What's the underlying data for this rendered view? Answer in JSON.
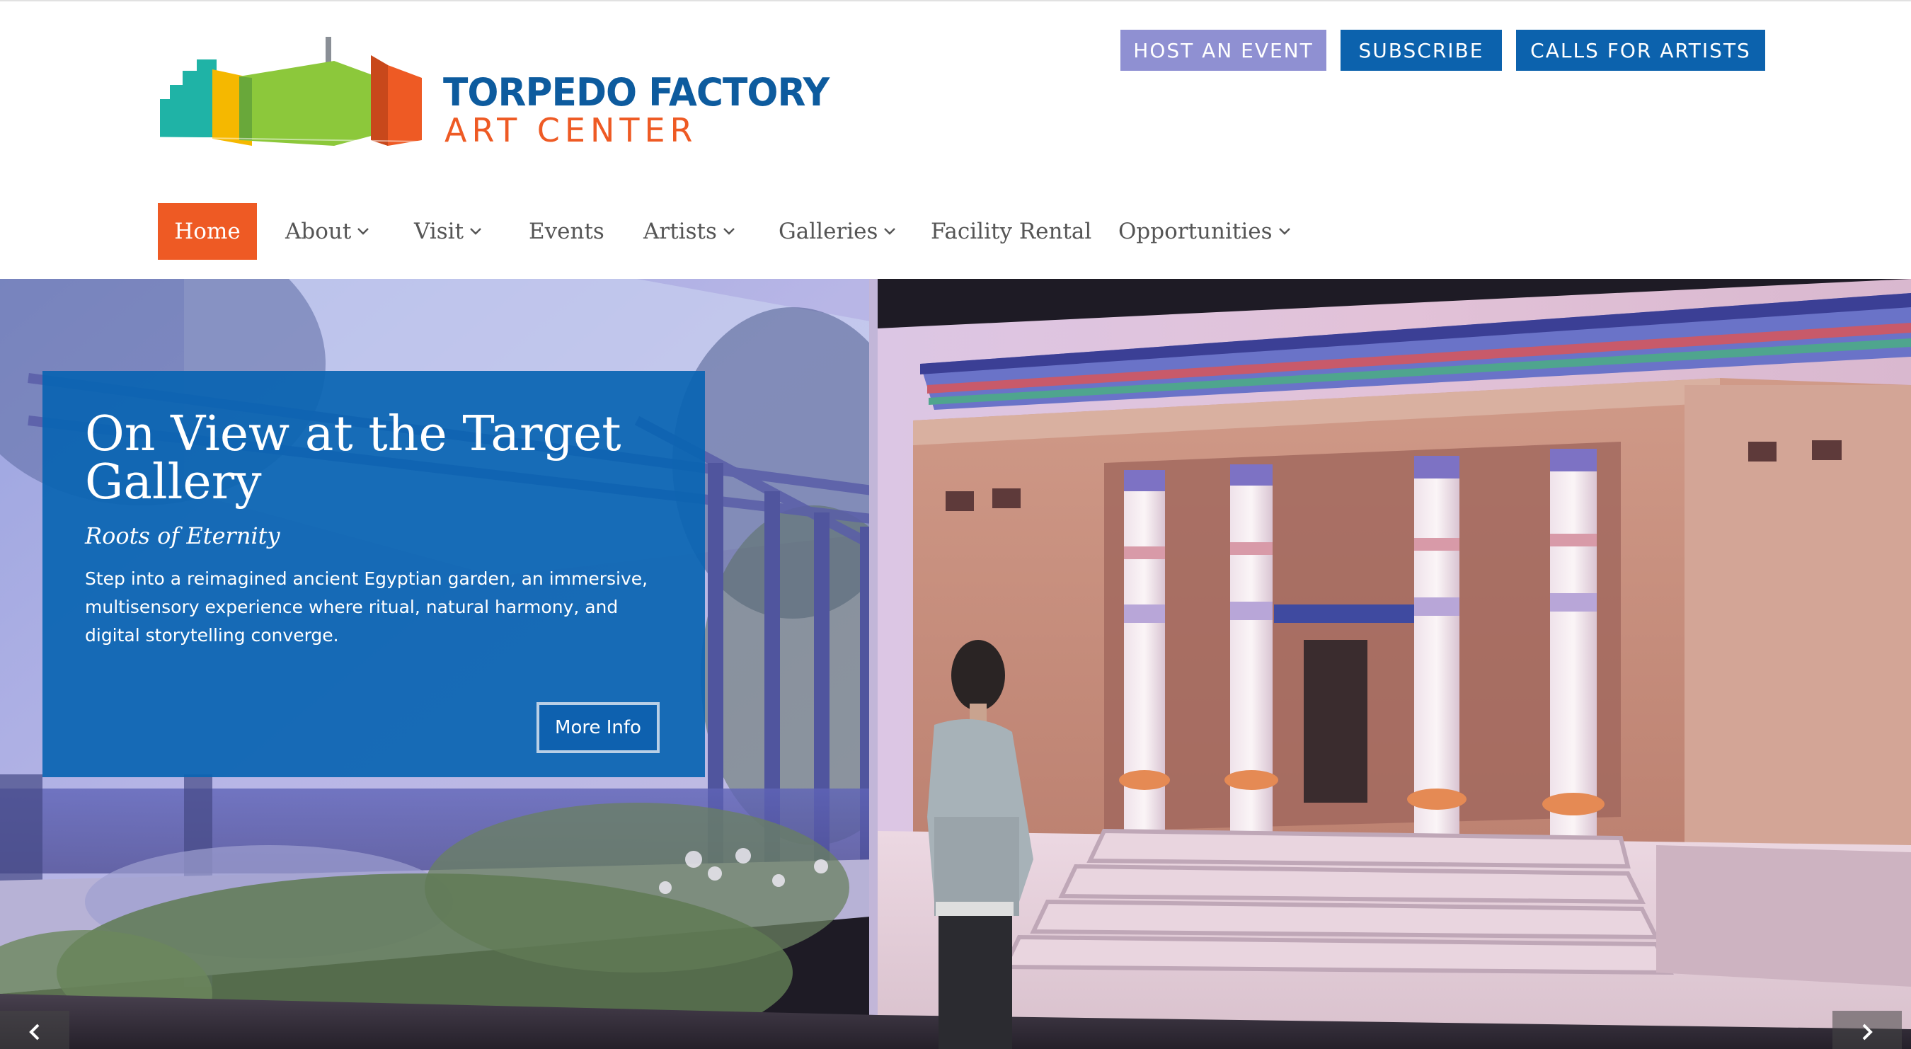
{
  "header": {
    "logo": {
      "line1": "TORPEDO FACTORY",
      "line2": "ART CENTER"
    },
    "utility_buttons": {
      "host": "HOST AN EVENT",
      "subscribe": "SUBSCRIBE",
      "calls": "CALLS FOR ARTISTS"
    }
  },
  "nav": {
    "items": [
      {
        "label": "Home",
        "active": true
      },
      {
        "label": "About",
        "dropdown": true
      },
      {
        "label": "Visit",
        "dropdown": true
      },
      {
        "label": "Events"
      },
      {
        "label": "Artists",
        "dropdown": true
      },
      {
        "label": "Galleries",
        "dropdown": true
      },
      {
        "label": "Facility Rental"
      },
      {
        "label": "Opportunities",
        "dropdown": true
      }
    ]
  },
  "hero": {
    "title": "On View at the Target Gallery",
    "subtitle": "Roots of Eternity",
    "description": "Step into a reimagined ancient Egyptian garden, an immersive, multisensory experience where ritual, natural harmony, and digital storytelling converge.",
    "button": "More Info"
  },
  "colors": {
    "accent_orange": "#ee5a24",
    "brand_blue": "#0c62ad",
    "host_button": "#8f90d2",
    "panel_blue": "#0964b2"
  },
  "icons": {
    "dropdown": "chevron-down-icon",
    "prev": "chevron-left-icon",
    "next": "chevron-right-icon"
  }
}
